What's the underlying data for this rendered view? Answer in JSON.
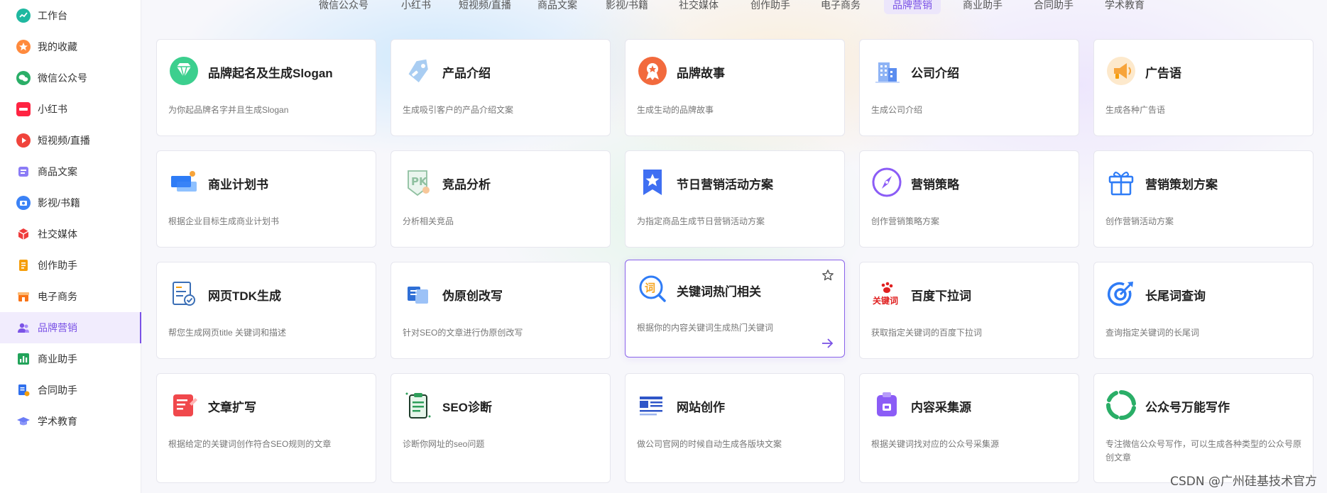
{
  "sidebar": {
    "items": [
      {
        "label": "工作台",
        "icon": "dashboard-icon",
        "color": "#1fb8a0"
      },
      {
        "label": "我的收藏",
        "icon": "star-icon",
        "color": "#ff8a3d"
      },
      {
        "label": "微信公众号",
        "icon": "wechat-icon",
        "color": "#2aae67"
      },
      {
        "label": "小红书",
        "icon": "xiaohongshu-icon",
        "color": "#ff2442"
      },
      {
        "label": "短视频/直播",
        "icon": "video-icon",
        "color": "#f0443c"
      },
      {
        "label": "商品文案",
        "icon": "product-icon",
        "color": "#8b7cf6"
      },
      {
        "label": "影视/书籍",
        "icon": "film-icon",
        "color": "#3b82f6"
      },
      {
        "label": "社交媒体",
        "icon": "cube-icon",
        "color": "#ef3b3b"
      },
      {
        "label": "创作助手",
        "icon": "note-icon",
        "color": "#f59e0b"
      },
      {
        "label": "电子商务",
        "icon": "shop-icon",
        "color": "#f97316"
      },
      {
        "label": "品牌营销",
        "icon": "users-icon",
        "color": "#7b53e6",
        "active": true
      },
      {
        "label": "商业助手",
        "icon": "bar-chart-icon",
        "color": "#22a35a"
      },
      {
        "label": "合同助手",
        "icon": "contract-icon",
        "color": "#2f6fed"
      },
      {
        "label": "学术教育",
        "icon": "graduation-icon",
        "color": "#6b7cf6"
      }
    ]
  },
  "tabs": [
    {
      "label": "微信公众号"
    },
    {
      "label": "小红书"
    },
    {
      "label": "短视频/直播"
    },
    {
      "label": "商品文案"
    },
    {
      "label": "影视/书籍"
    },
    {
      "label": "社交媒体"
    },
    {
      "label": "创作助手"
    },
    {
      "label": "电子商务"
    },
    {
      "label": "品牌营销",
      "active": true
    },
    {
      "label": "商业助手"
    },
    {
      "label": "合同助手"
    },
    {
      "label": "学术教育"
    }
  ],
  "cards": [
    {
      "title": "品牌起名及生成Slogan",
      "desc": "为你起品牌名字并且生成Slogan",
      "icon": "diamond-icon",
      "color": "#3ccf8e"
    },
    {
      "title": "产品介绍",
      "desc": "生成吸引客户的产品介绍文案",
      "icon": "tag-icon",
      "color": "#7fb6ee"
    },
    {
      "title": "品牌故事",
      "desc": "生成生动的品牌故事",
      "icon": "badge-icon",
      "color": "#f26a3d"
    },
    {
      "title": "公司介绍",
      "desc": "生成公司介绍",
      "icon": "building-icon",
      "color": "#5b8def"
    },
    {
      "title": "广告语",
      "desc": "生成各种广告语",
      "icon": "megaphone-icon",
      "color": "#f7a43a"
    },
    {
      "title": "商业计划书",
      "desc": "根据企业目标生成商业计划书",
      "icon": "plan-icon",
      "color": "#2f7cf6"
    },
    {
      "title": "竞品分析",
      "desc": "分析相关竞品",
      "icon": "pk-icon",
      "color": "#8fc0a0"
    },
    {
      "title": "节日营销活动方案",
      "desc": "为指定商品生成节日营销活动方案",
      "icon": "ribbon-star-icon",
      "color": "#3f6ff2"
    },
    {
      "title": "营销策略",
      "desc": "创作营销策略方案",
      "icon": "compass-icon",
      "color": "#8b5cf6"
    },
    {
      "title": "营销策划方案",
      "desc": "创作营销活动方案",
      "icon": "gift-icon",
      "color": "#2f7cf6"
    },
    {
      "title": "网页TDK生成",
      "desc": "帮您生成网页title 关键词和描述",
      "icon": "doc-check-icon",
      "color": "#3b6fb6"
    },
    {
      "title": "伪原创改写",
      "desc": "针对SEO的文章进行伪原创改写",
      "icon": "rewrite-icon",
      "color": "#2f6fd6"
    },
    {
      "title": "关键词热门相关",
      "desc": "根据你的内容关键词生成热门关键词",
      "icon": "search-word-icon",
      "color": "#f5a623",
      "highlight": true
    },
    {
      "title": "百度下拉词",
      "desc": "获取指定关键词的百度下拉词",
      "icon": "baidu-keyword-icon",
      "color": "#e02020"
    },
    {
      "title": "长尾词查询",
      "desc": "查询指定关键词的长尾词",
      "icon": "target-icon",
      "color": "#2f7cf6"
    },
    {
      "title": "文章扩写",
      "desc": "根据给定的关键词创作符合SEO规则的文章",
      "icon": "article-icon",
      "color": "#f0484c"
    },
    {
      "title": "SEO诊断",
      "desc": "诊断你网址的seo问题",
      "icon": "clipboard-icon",
      "color": "#2e9e5a"
    },
    {
      "title": "网站创作",
      "desc": "做公司官网的时候自动生成各版块文案",
      "icon": "website-icon",
      "color": "#2f56c8"
    },
    {
      "title": "内容采集源",
      "desc": "根据关键词找对应的公众号采集源",
      "icon": "collect-icon",
      "color": "#8b5cf6"
    },
    {
      "title": "公众号万能写作",
      "desc": "专注微信公众号写作，可以生成各种类型的公众号原创文章",
      "icon": "wechat-write-icon",
      "color": "#2aae67"
    }
  ],
  "watermark": "CSDN @广州硅基技术官方"
}
